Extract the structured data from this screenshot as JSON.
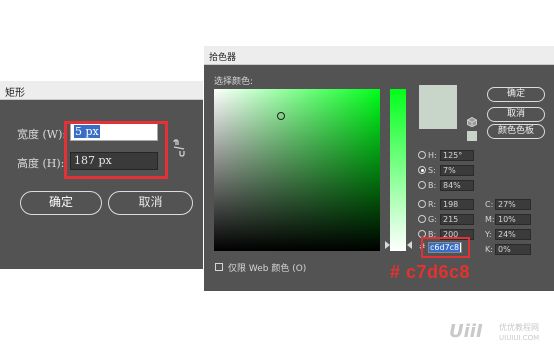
{
  "rect_dialog": {
    "title": "矩形",
    "width_label": "宽度 (W):",
    "width_value": "5 px",
    "height_label": "高度 (H):",
    "height_value": "187 px",
    "ok_label": "确定",
    "cancel_label": "取消",
    "link_icon": "link-broken-icon"
  },
  "color_picker": {
    "title": "拾色器",
    "pick_label": "选择颜色:",
    "ok_label": "确定",
    "cancel_label": "取消",
    "swatches_label": "颜色色板",
    "hsb": [
      {
        "label": "H:",
        "value": "125°"
      },
      {
        "label": "S:",
        "value": "7%"
      },
      {
        "label": "B:",
        "value": "84%"
      }
    ],
    "rgb": [
      {
        "label": "R:",
        "value": "198"
      },
      {
        "label": "G:",
        "value": "215"
      },
      {
        "label": "B:",
        "value": "200"
      }
    ],
    "cmyk": [
      {
        "label": "C:",
        "value": "27%"
      },
      {
        "label": "M:",
        "value": "10%"
      },
      {
        "label": "Y:",
        "value": "24%"
      },
      {
        "label": "K:",
        "value": "0%"
      }
    ],
    "hex_hash": "#",
    "hex_value": "c6d7c8",
    "web_only_label": "仅限 Web 颜色 (O)",
    "selected_color": "#c7d6c8",
    "annotation": "# c7d6c8"
  },
  "watermark": {
    "logo_text": "UiiI",
    "cn_text": "优优教程网",
    "url_text": "UIUIUI.COM"
  },
  "colors": {
    "dialog_bg": "#535353",
    "highlight_red": "#e53035",
    "selection_blue": "#3a6ec6"
  }
}
